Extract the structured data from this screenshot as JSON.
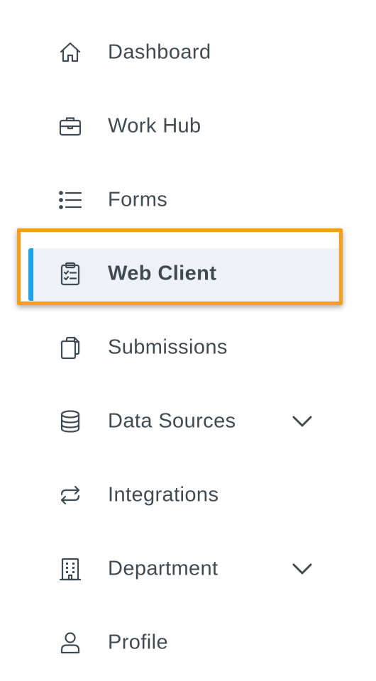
{
  "nav": {
    "items": [
      {
        "label": "Dashboard",
        "icon": "home-icon"
      },
      {
        "label": "Work Hub",
        "icon": "briefcase-icon"
      },
      {
        "label": "Forms",
        "icon": "list-icon"
      },
      {
        "label": "Web Client",
        "icon": "clipboard-check-icon",
        "active": true
      },
      {
        "label": "Submissions",
        "icon": "copy-icon"
      },
      {
        "label": "Data Sources",
        "icon": "database-icon",
        "expandable": true
      },
      {
        "label": "Integrations",
        "icon": "sync-icon"
      },
      {
        "label": "Department",
        "icon": "building-icon",
        "expandable": true
      },
      {
        "label": "Profile",
        "icon": "user-icon"
      }
    ]
  },
  "colors": {
    "text": "#3f4a52",
    "active_bar": "#1aa3e8",
    "active_bg": "#eef2f7",
    "highlight_border": "#f4a01c"
  }
}
